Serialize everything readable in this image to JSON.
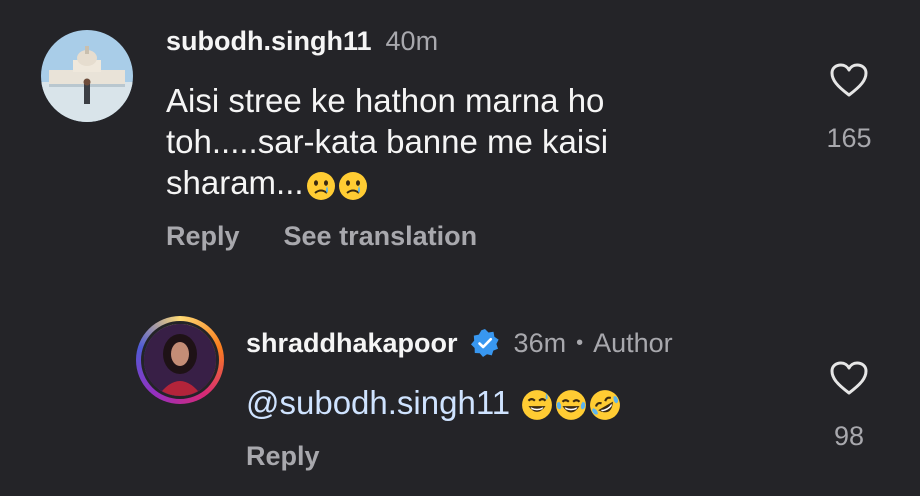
{
  "comments": [
    {
      "username": "subodh.singh11",
      "time": "40m",
      "text": "Aisi stree ke hathon marna ho toh.....sar-kata banne me kaisi sharam...",
      "emojis": [
        "crying-face",
        "crying-face"
      ],
      "likes": "165",
      "reply_label": "Reply",
      "translate_label": "See translation"
    },
    {
      "username": "shraddhakapoor",
      "time": "36m",
      "separator": "•",
      "author_label": "Author",
      "mention": "@subodh.singh11",
      "emojis": [
        "grinning-sweat-face",
        "tears-of-joy-face",
        "rolling-on-floor-laughing-face"
      ],
      "likes": "98",
      "reply_label": "Reply"
    }
  ],
  "colors": {
    "background": "#242428",
    "primary_text": "#f5f5f5",
    "secondary_text": "#a8a8ad",
    "verified_badge": "#3897f0",
    "emoji_yellow": "#ffcc33"
  }
}
